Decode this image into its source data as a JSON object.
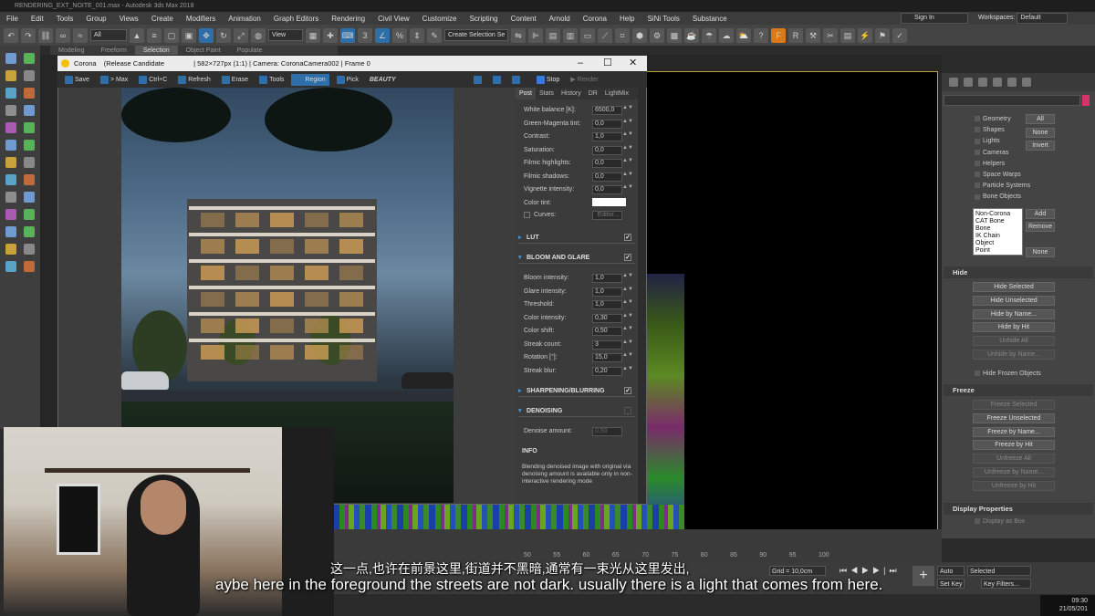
{
  "window": {
    "title": "RENDERING_EXT_NOITE_001.max - Autodesk 3ds Max 2018"
  },
  "menubar": [
    "File",
    "Edit",
    "Tools",
    "Group",
    "Views",
    "Create",
    "Modifiers",
    "Animation",
    "Graph Editors",
    "Rendering",
    "Civil View",
    "Customize",
    "Scripting",
    "Content",
    "Arnold",
    "Corona",
    "Help",
    "SiNi Tools",
    "Substance"
  ],
  "account": {
    "signin": "Sign In",
    "workspaces_label": "Workspaces:",
    "workspace_value": "Default"
  },
  "toolbar": {
    "filter": "All",
    "view": "View",
    "selection_set": "Create Selection Se",
    "percent_icon": "%",
    "angle_icon": "3"
  },
  "ribbon": [
    "Modeling",
    "Freeform",
    "Selection",
    "Object Paint",
    "Populate"
  ],
  "vfb": {
    "app": "Corona",
    "build": "(Release Candidate",
    "info": "| 582×727px (1:1) | Camera: CoronaCamera002 | Frame 0",
    "tools": {
      "save": "Save",
      "max": "> Max",
      "ctrlc": "Ctrl+C",
      "refresh": "Refresh",
      "erase": "Erase",
      "tools": "Tools",
      "region": "Region",
      "pick": "Pick",
      "pass": "BEAUTY",
      "stop": "Stop",
      "render": "Render"
    },
    "tabs": [
      "Post",
      "Stats",
      "History",
      "DR",
      "LightMix"
    ]
  },
  "post": {
    "tone": [
      {
        "label": "White balance [K]:",
        "value": "6500,0"
      },
      {
        "label": "Green-Magenta tint:",
        "value": "0,0"
      },
      {
        "label": "Contrast:",
        "value": "1,0"
      },
      {
        "label": "Saturation:",
        "value": "0,0"
      },
      {
        "label": "Filmic highlights:",
        "value": "0,0"
      },
      {
        "label": "Filmic shadows:",
        "value": "0,0"
      },
      {
        "label": "Vignette intensity:",
        "value": "0,0"
      },
      {
        "label": "Color tint:",
        "value": ""
      }
    ],
    "curves_label": "Curves:",
    "curves_btn": "Editor...",
    "lut": "LUT",
    "bloom_header": "BLOOM AND GLARE",
    "bloom": [
      {
        "label": "Bloom intensity:",
        "value": "1,0"
      },
      {
        "label": "Glare intensity:",
        "value": "1,0"
      },
      {
        "label": "Threshold:",
        "value": "1,0"
      },
      {
        "label": "Color intensity:",
        "value": "0,30"
      },
      {
        "label": "Color shift:",
        "value": "0,50"
      },
      {
        "label": "Streak count:",
        "value": "3"
      },
      {
        "label": "Rotation [°]:",
        "value": "15,0"
      },
      {
        "label": "Streak blur:",
        "value": "0,20"
      }
    ],
    "sharpening": "SHARPENING/BLURRING",
    "denoising": "DENOISING",
    "denoise_label": "Denoise amount:",
    "denoise_value": "0,50",
    "info_header": "INFO",
    "info_text": "Blending denoised image with original via denoising amount is available only in non-interactive rendering mode"
  },
  "rightpanel": {
    "categories": [
      "Geometry",
      "Shapes",
      "Lights",
      "Cameras",
      "Helpers",
      "Space Warps",
      "Particle Systems",
      "Bone Objects"
    ],
    "btn_all": "All",
    "btn_none": "None",
    "btn_invert": "Invert",
    "bone_list": [
      "Non-Corona",
      "CAT Bone",
      "Bone",
      "IK Chain Object",
      "Point"
    ],
    "btn_add": "Add",
    "btn_remove": "Remove",
    "btn_none2": "None",
    "hide_header": "Hide",
    "hide_buttons": [
      "Hide Selected",
      "Hide Unselected",
      "Hide by Name...",
      "Hide by Hit",
      "Unhide All",
      "Unhide by Name..."
    ],
    "hide_frozen": "Hide Frozen Objects",
    "freeze_header": "Freeze",
    "freeze_buttons": [
      "Freeze Selected",
      "Freeze Unselected",
      "Freeze by Name...",
      "Freeze by Hit",
      "Unfreeze All",
      "Unfreeze by Name...",
      "Unfreeze by Hit"
    ],
    "display_header": "Display Properties",
    "display_as_box": "Display as Box"
  },
  "timeline": {
    "ticks": [
      "50",
      "55",
      "60",
      "65",
      "70",
      "75",
      "80",
      "85",
      "90",
      "95",
      "100"
    ],
    "grid": "Grid = 10,0cm",
    "autokey": "Auto Key",
    "setkey": "Set Key",
    "selected": "Selected",
    "keyfilters": "Key Filters..."
  },
  "subtitles": {
    "cn": "这一点,也许在前景这里,街道并不黑暗,通常有一束光从这里发出,",
    "en": "aybe here in the foreground the streets are not dark. usually there is a light that comes from here."
  },
  "clock": {
    "time": "09:30",
    "date": "21/05/201"
  }
}
